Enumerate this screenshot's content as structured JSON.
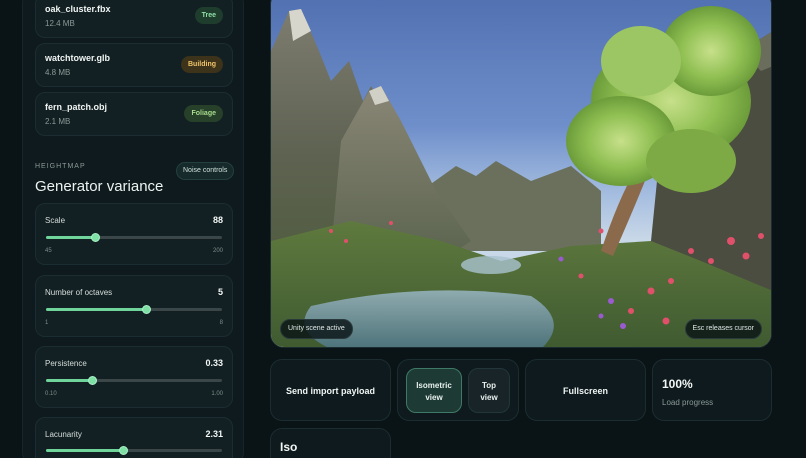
{
  "assets": [
    {
      "name": "oak_cluster.fbx",
      "size": "12.4 MB",
      "tag": "Tree"
    },
    {
      "name": "watchtower.glb",
      "size": "4.8 MB",
      "tag": "Building"
    },
    {
      "name": "fern_patch.obj",
      "size": "2.1 MB",
      "tag": "Foliage"
    }
  ],
  "heightmap": {
    "kicker": "HEIGHTMAP",
    "title": "Generator variance",
    "noise_button": "Noise controls"
  },
  "sliders": [
    {
      "label": "Scale",
      "value": "88",
      "min": "45",
      "max": "200",
      "fraction": 0.28
    },
    {
      "label": "Number of octaves",
      "value": "5",
      "min": "1",
      "max": "8",
      "fraction": 0.57
    },
    {
      "label": "Persistence",
      "value": "0.33",
      "min": "0.10",
      "max": "1.00",
      "fraction": 0.26
    },
    {
      "label": "Lacunarity",
      "value": "2.31",
      "min": "",
      "max": "",
      "fraction": 0.44
    }
  ],
  "viewport": {
    "status": "Unity scene active",
    "hint": "Esc releases cursor"
  },
  "controls": {
    "send_payload": "Send import payload",
    "isometric_view": "Isometric view",
    "top_view": "Top view",
    "fullscreen": "Fullscreen",
    "progress_value": "100%",
    "progress_label": "Load progress",
    "mode_label": "Iso"
  },
  "colors": {
    "accent": "#6fd59a",
    "background": "#0a1316",
    "panel": "#0e1a1d"
  }
}
